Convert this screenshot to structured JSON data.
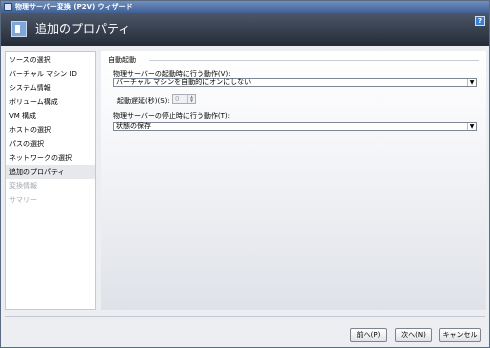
{
  "window": {
    "title": "物理サーバー変換 (P2V) ウィザード"
  },
  "header": {
    "page_title": "追加のプロパティ",
    "help_label": "?"
  },
  "sidebar": {
    "items": [
      {
        "label": "ソースの選択",
        "state": "normal"
      },
      {
        "label": "バーチャル マシン ID",
        "state": "normal"
      },
      {
        "label": "システム情報",
        "state": "normal"
      },
      {
        "label": "ボリューム構成",
        "state": "normal"
      },
      {
        "label": "VM 構成",
        "state": "normal"
      },
      {
        "label": "ホストの選択",
        "state": "normal"
      },
      {
        "label": "パスの選択",
        "state": "normal"
      },
      {
        "label": "ネットワークの選択",
        "state": "normal"
      },
      {
        "label": "追加のプロパティ",
        "state": "active"
      },
      {
        "label": "変換情報",
        "state": "disabled"
      },
      {
        "label": "サマリー",
        "state": "disabled"
      }
    ]
  },
  "main": {
    "group_title": "自動起動",
    "start_action_label": "物理サーバーの起動時に行う動作(V):",
    "start_action_value": "バーチャル マシンを自動的にオンにしない",
    "delay_label": "起動遅延(秒)(S):",
    "delay_value": "0",
    "stop_action_label": "物理サーバーの停止時に行う動作(T):",
    "stop_action_value": "状態の保存"
  },
  "footer": {
    "back_label": "前へ(P)",
    "next_label": "次へ(N)",
    "cancel_label": "キャンセル"
  }
}
